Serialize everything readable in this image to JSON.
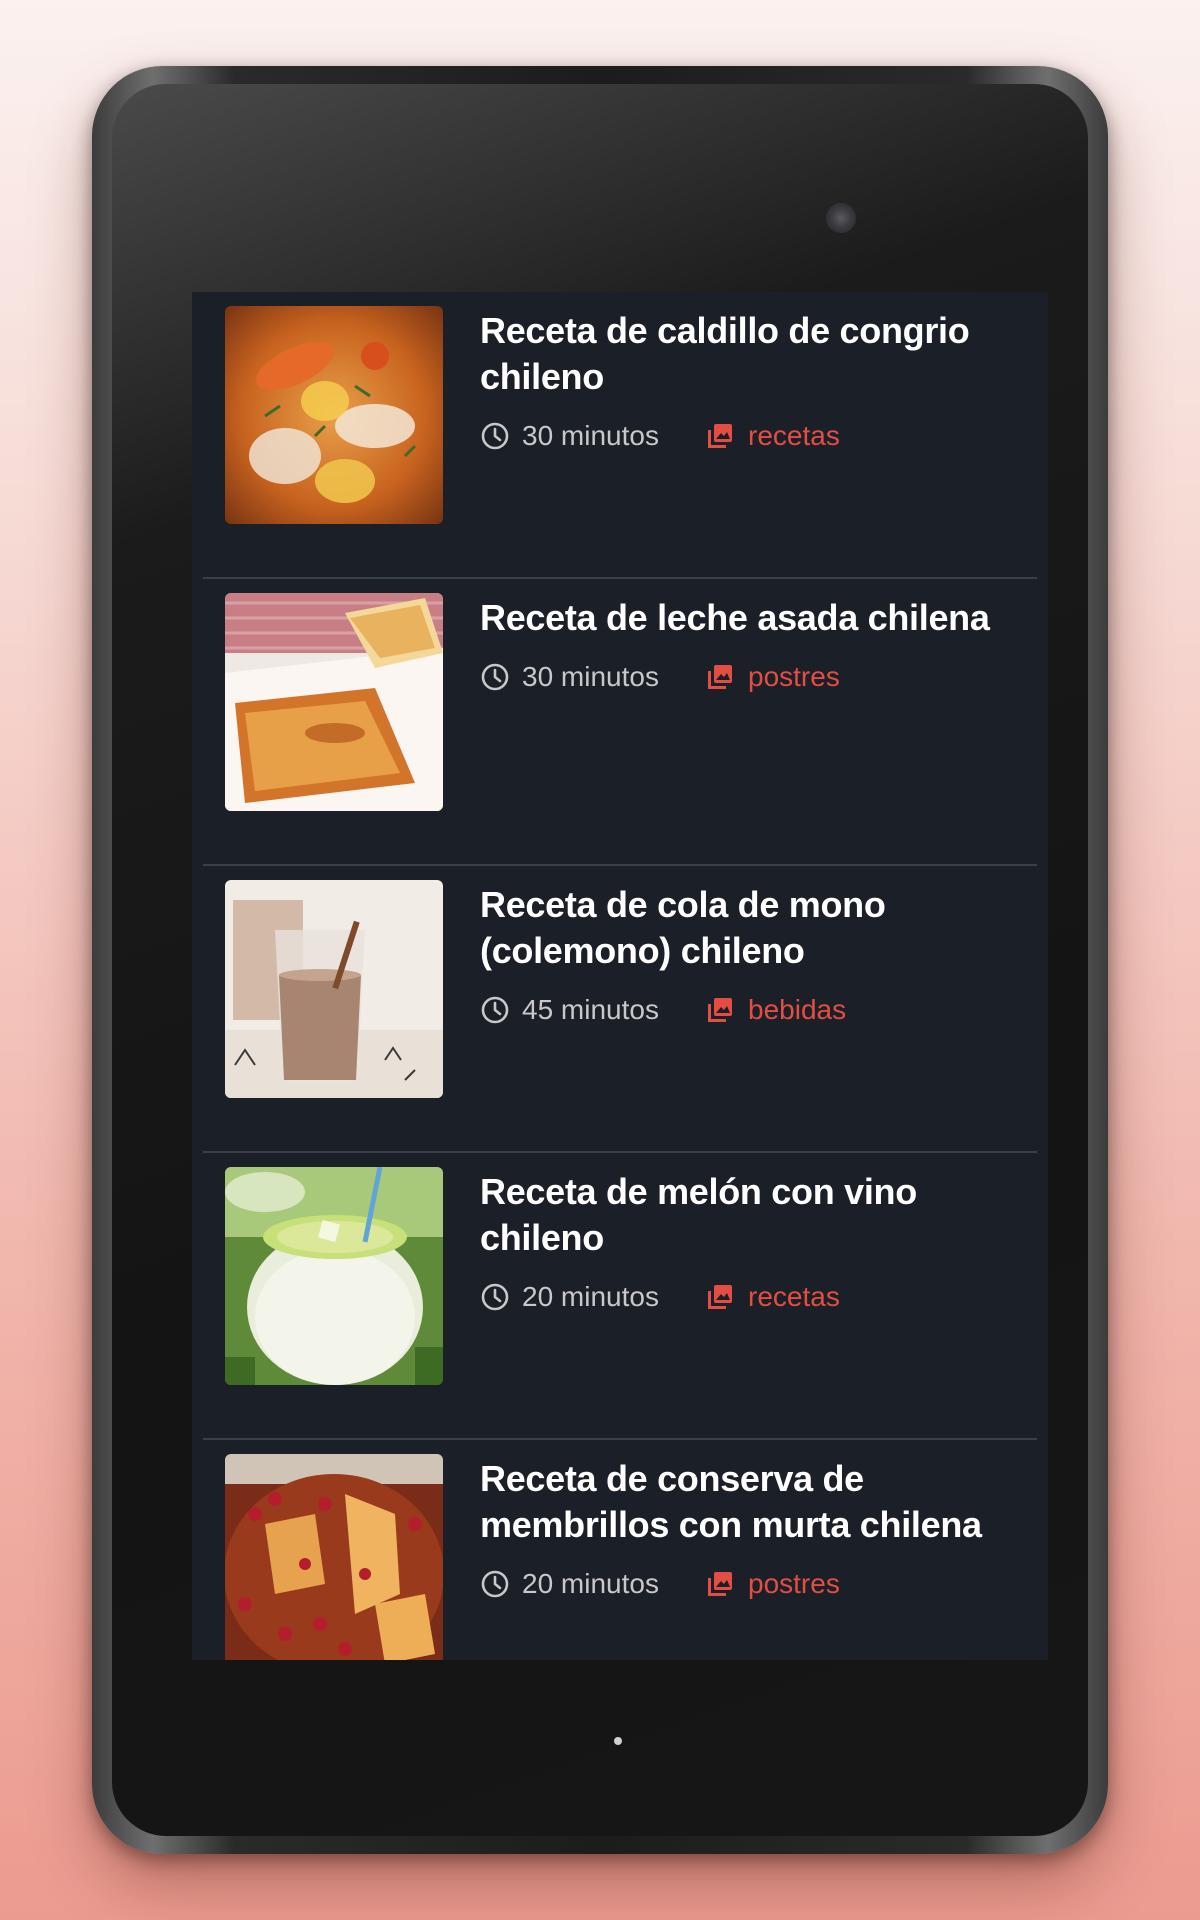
{
  "theme": {
    "accent": "#e24e44",
    "screen_bg": "#1b1f27",
    "title_color": "#ffffff",
    "meta_color": "#c8c8c8"
  },
  "recipes": [
    {
      "title": "Receta de caldillo de congrio chileno",
      "time": "30 minutos",
      "category": "recetas",
      "time_icon": "clock-icon",
      "category_icon": "gallery-icon"
    },
    {
      "title": "Receta de leche asada chilena",
      "time": "30 minutos",
      "category": "postres",
      "time_icon": "clock-icon",
      "category_icon": "gallery-icon"
    },
    {
      "title": "Receta de cola de mono (colemono) chileno",
      "time": "45 minutos",
      "category": "bebidas",
      "time_icon": "clock-icon",
      "category_icon": "gallery-icon"
    },
    {
      "title": "Receta de melón con vino chileno",
      "time": "20 minutos",
      "category": "recetas",
      "time_icon": "clock-icon",
      "category_icon": "gallery-icon"
    },
    {
      "title": "Receta de conserva de membrillos con murta chilena",
      "time": "20 minutos",
      "category": "postres",
      "time_icon": "clock-icon",
      "category_icon": "gallery-icon"
    }
  ]
}
